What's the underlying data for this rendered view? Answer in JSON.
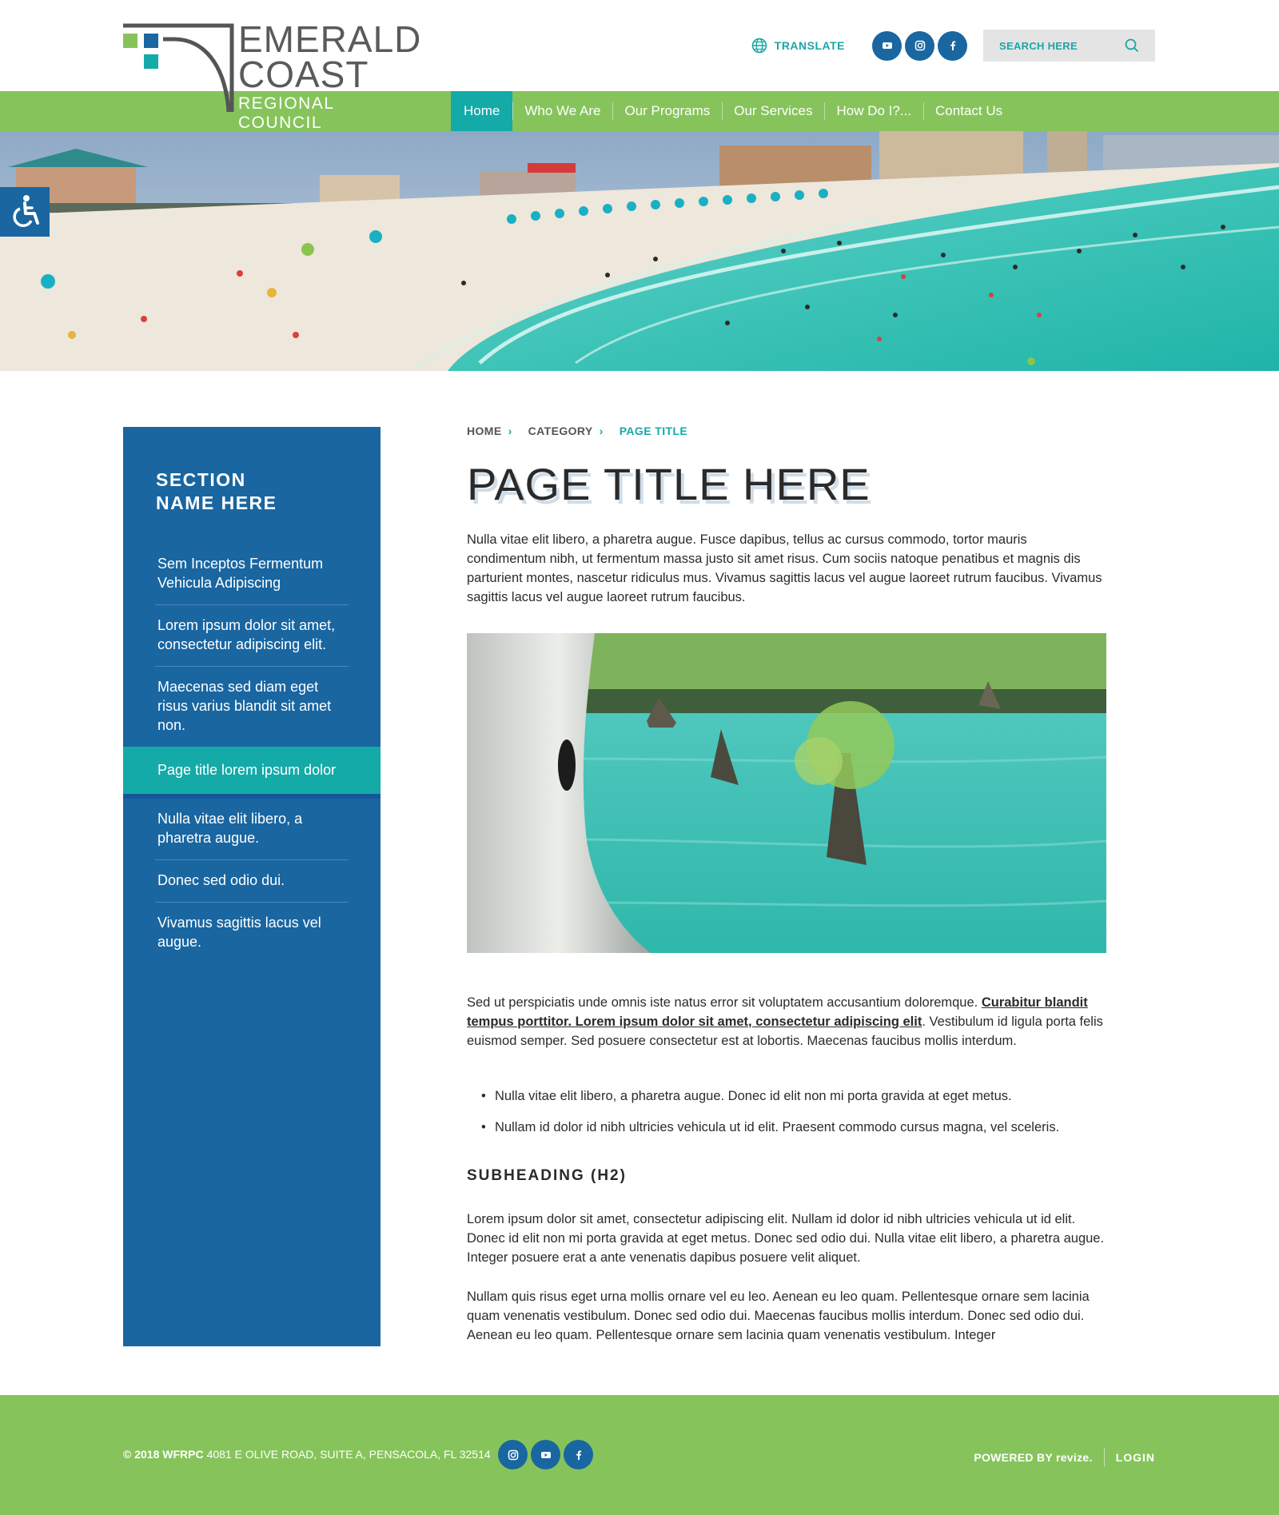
{
  "logo": {
    "line1": "EMERALD",
    "line2": "COAST",
    "line3": "REGIONAL COUNCIL"
  },
  "header": {
    "translate_label": "TRANSLATE",
    "social_icons": [
      "youtube-icon",
      "instagram-icon",
      "facebook-icon"
    ],
    "search_placeholder": "SEARCH HERE"
  },
  "nav": {
    "items": [
      {
        "label": "Home",
        "active": true
      },
      {
        "label": "Who We Are"
      },
      {
        "label": "Our Programs"
      },
      {
        "label": "Our Services"
      },
      {
        "label": "How Do I?..."
      },
      {
        "label": "Contact Us"
      }
    ]
  },
  "sidebar": {
    "title_line1": "SECTION",
    "title_line2": "NAME HERE",
    "items": [
      {
        "label": "Sem Inceptos Fermentum Vehicula Adipiscing"
      },
      {
        "label": "Lorem ipsum dolor sit amet, consectetur adipiscing elit."
      },
      {
        "label": "Maecenas sed diam eget risus varius blandit sit amet non."
      },
      {
        "label": "Page title lorem ipsum dolor",
        "active": true
      },
      {
        "label": "Nulla vitae elit libero, a pharetra augue."
      },
      {
        "label": "Donec sed odio dui."
      },
      {
        "label": "Vivamus sagittis lacus vel augue."
      }
    ]
  },
  "breadcrumb": {
    "home": "HOME",
    "category": "CATEGORY",
    "current": "PAGE TITLE"
  },
  "content": {
    "title": "PAGE TITLE HERE",
    "intro": "Nulla vitae elit libero, a pharetra augue. Fusce dapibus, tellus ac cursus commodo, tortor mauris condimentum nibh, ut fermentum massa justo sit amet risus. Cum sociis natoque penatibus et magnis dis parturient montes, nascetur ridiculus mus. Vivamus sagittis lacus vel augue laoreet rutrum faucibus. Vivamus sagittis lacus vel augue laoreet rutrum faucibus.",
    "para2_start": "Sed ut perspiciatis unde omnis iste natus error sit voluptatem accusantium doloremque. ",
    "para2_link": "Curabitur blandit tempus porttitor. Lorem ipsum dolor sit amet, consectetur adipiscing elit",
    "para2_end": ". Vestibulum id ligula porta felis euismod semper. Sed posuere consectetur est at lobortis. Maecenas faucibus mollis interdum.",
    "bullets": [
      "Nulla vitae elit libero, a pharetra augue. Donec id elit non mi porta gravida at eget metus.",
      "Nullam id dolor id nibh ultricies vehicula ut id elit. Praesent commodo cursus magna, vel sceleris."
    ],
    "subheading": "SUBHEADING (H2)",
    "para3": "Lorem ipsum dolor sit amet, consectetur adipiscing elit. Nullam id dolor id nibh ultricies vehicula ut id elit. Donec id elit non mi porta gravida at eget metus. Donec sed odio dui. Nulla vitae elit libero, a pharetra augue. Integer posuere erat a ante venenatis dapibus posuere velit aliquet.",
    "para4": "Nullam quis risus eget urna mollis ornare vel eu leo. Aenean eu leo quam. Pellentesque ornare sem lacinia quam venenatis vestibulum. Donec sed odio dui. Maecenas faucibus mollis interdum. Donec sed odio dui. Aenean eu leo quam. Pellentesque ornare sem lacinia quam venenatis vestibulum. Integer"
  },
  "footer": {
    "copyright": "© 2018 WFRPC",
    "address": "4081 E OLIVE ROAD, SUITE A, PENSACOLA, FL 32514",
    "social_icons": [
      "instagram-icon",
      "youtube-icon",
      "facebook-icon"
    ],
    "powered_by": "POWERED BY revize.",
    "login": "LOGIN"
  },
  "colors": {
    "green": "#86c45b",
    "blue": "#1966a1",
    "teal": "#14aaa8"
  }
}
